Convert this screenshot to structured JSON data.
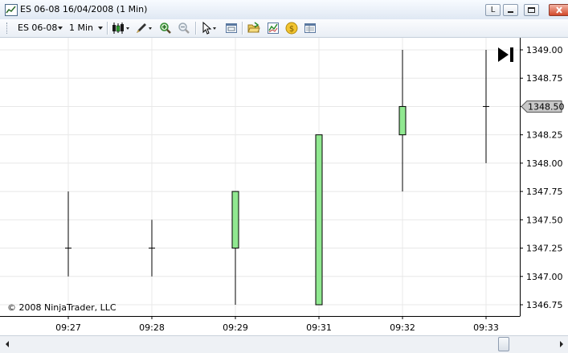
{
  "window": {
    "title": "ES 06-08  16/04/2008 (1 Min)",
    "buttons": {
      "link": "L",
      "minimize": "",
      "maximize": "",
      "close": ""
    }
  },
  "toolbar": {
    "instrument": "ES 06-08",
    "interval": "1 Min",
    "icons": [
      "candlestick-style-icon",
      "draw-tools-icon",
      "zoom-in-icon",
      "zoom-out-icon",
      "cursor-icon",
      "properties-icon",
      "folder-icon",
      "indicators-icon",
      "strategies-icon",
      "data-box-icon"
    ]
  },
  "chart_data": {
    "type": "candlestick",
    "instrument": "ES 06-08",
    "interval": "1 Min",
    "categories": [
      "09:27",
      "09:28",
      "09:29",
      "09:31",
      "09:32",
      "09:33"
    ],
    "series": [
      {
        "time": "09:27",
        "open": 1347.25,
        "high": 1347.75,
        "low": 1347.0,
        "close": 1347.25
      },
      {
        "time": "09:28",
        "open": 1347.25,
        "high": 1347.5,
        "low": 1347.0,
        "close": 1347.25
      },
      {
        "time": "09:29",
        "open": 1347.25,
        "high": 1347.75,
        "low": 1346.75,
        "close": 1347.75
      },
      {
        "time": "09:31",
        "open": 1346.75,
        "high": 1348.25,
        "low": 1346.75,
        "close": 1348.25
      },
      {
        "time": "09:32",
        "open": 1348.25,
        "high": 1349.0,
        "low": 1347.75,
        "close": 1348.5
      },
      {
        "time": "09:33",
        "open": 1348.5,
        "high": 1349.0,
        "low": 1348.0,
        "close": 1348.5
      }
    ],
    "y_ticks": [
      "1349.00",
      "1348.75",
      "1348.50",
      "1348.25",
      "1348.00",
      "1347.75",
      "1347.50",
      "1347.25",
      "1347.00",
      "1346.75"
    ],
    "ylim": [
      1346.75,
      1349.0
    ],
    "last_price": "1348.50",
    "copyright": "© 2008 NinjaTrader, LLC",
    "up_color": "#90e890",
    "grid": true
  },
  "colors": {
    "up_bar": "#90e890",
    "grid": "#e8e8e8",
    "axis": "#000000",
    "price_marker": "#c8c8c8"
  }
}
